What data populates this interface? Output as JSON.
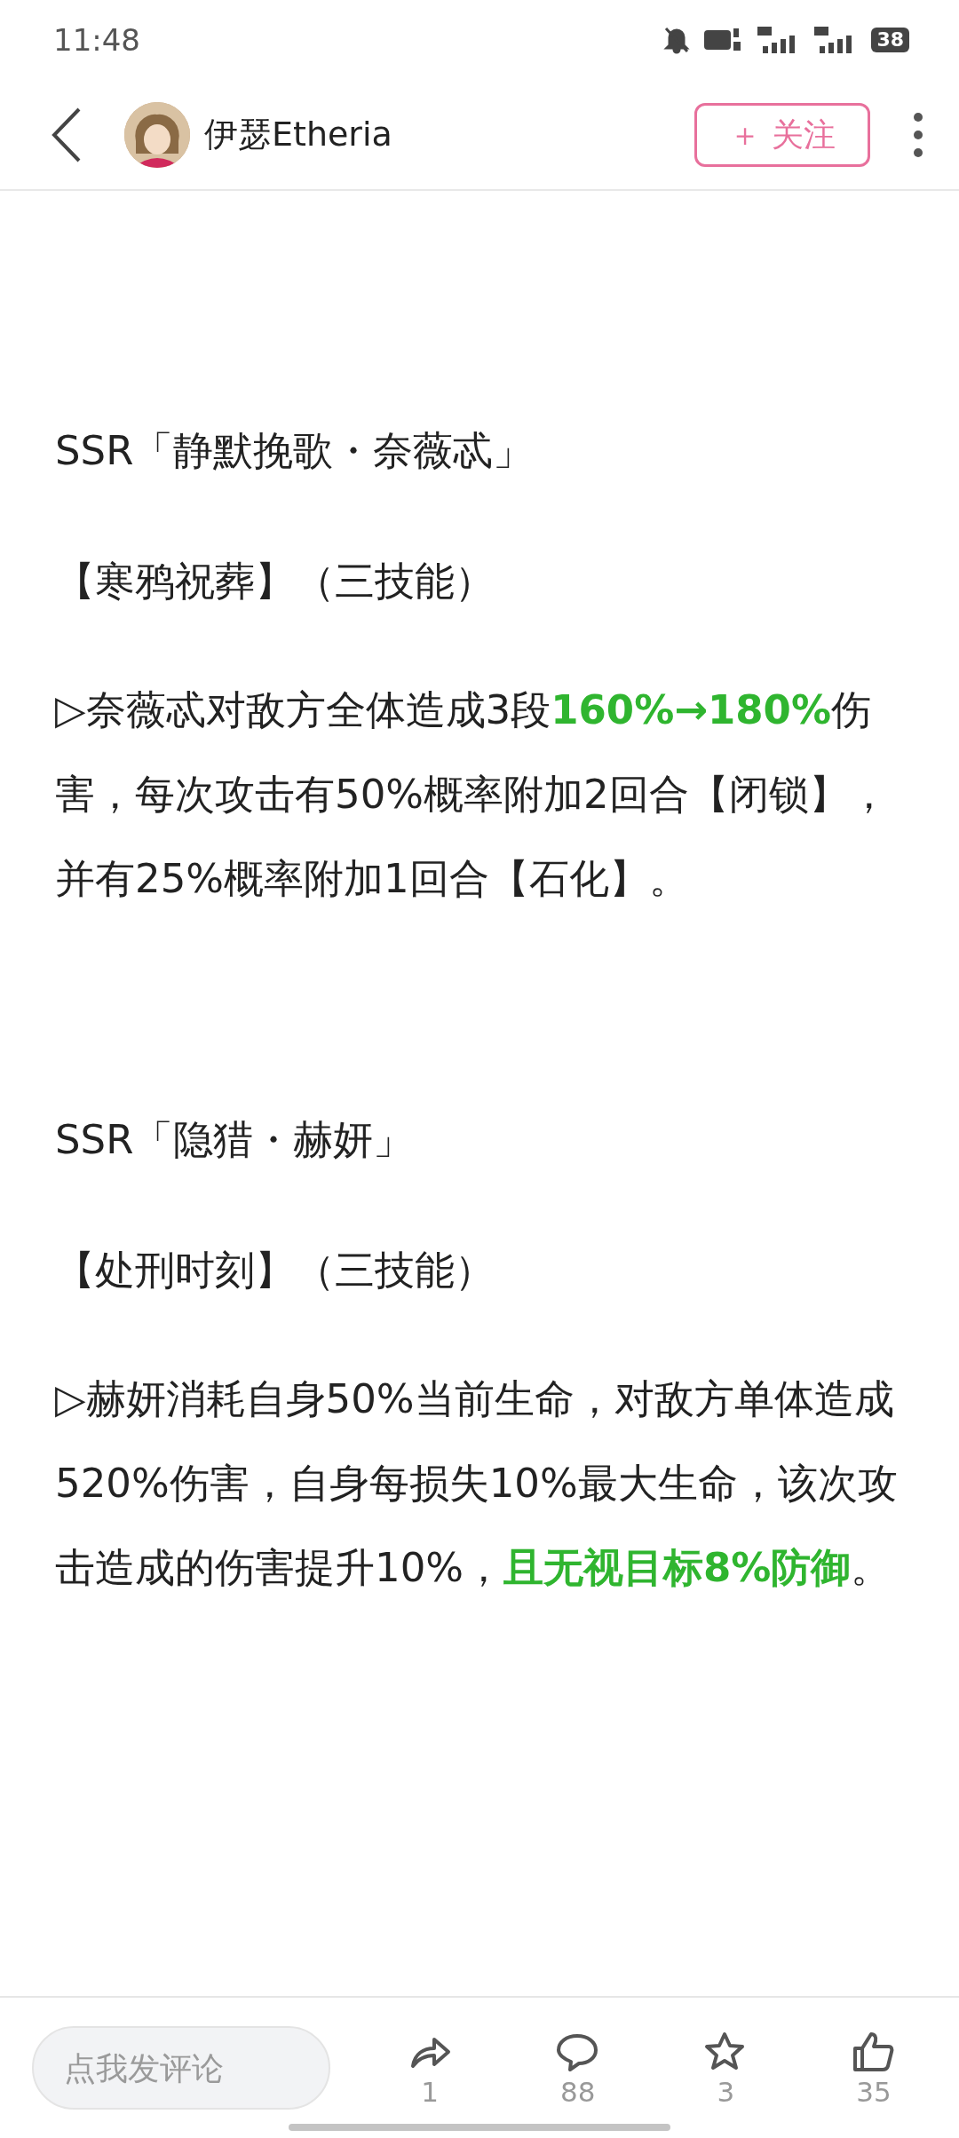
{
  "status_bar": {
    "time": "11:48",
    "battery": "38"
  },
  "header": {
    "author": "伊瑟Etheria",
    "follow_button": "＋ 关注"
  },
  "content": [
    {
      "kind": "title",
      "text": "SSR「静默挽歌・奈薇忒」"
    },
    {
      "kind": "skill",
      "text": "【寒鸦祝葬】（三技能）"
    },
    {
      "kind": "para",
      "text": "▷奈薇忒对敌方全体造成3段**160%→180%**伤害，每次攻击有50%概率附加2回合【闭锁】，并有25%概率附加1回合【石化】。"
    },
    {
      "kind": "title",
      "text": "SSR「隐猎・赫妍」"
    },
    {
      "kind": "skill",
      "text": "【处刑时刻】（三技能）"
    },
    {
      "kind": "para",
      "text": "▷赫妍消耗自身50%当前生命，对敌方单体造成520%伤害，自身每损失10%最大生命，该次攻击造成的伤害提升10%，**且无视目标8%防御**。"
    }
  ],
  "bottom_bar": {
    "comment": {
      "placeholder": "点我发评论"
    },
    "actions": [
      {
        "kind": "share",
        "count": "1"
      },
      {
        "kind": "comment",
        "count": "88"
      },
      {
        "kind": "favorite",
        "count": "3"
      },
      {
        "kind": "like",
        "count": "35"
      }
    ]
  }
}
